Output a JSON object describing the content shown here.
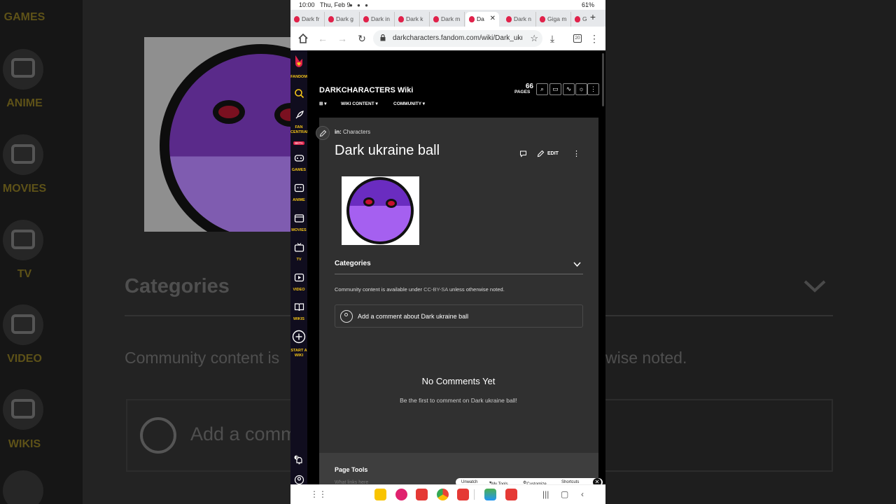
{
  "background": {
    "rail_items": [
      "GAMES",
      "ANIME",
      "MOVIES",
      "TV",
      "VIDEO",
      "WIKIS"
    ],
    "categories_label": "Categories",
    "license_fragment": "Community content is",
    "license_fragment_right": "wise noted.",
    "comment_fragment": "Add a comm"
  },
  "status_bar": {
    "time": "10:00",
    "date": "Thu, Feb 9",
    "battery": "61%"
  },
  "tabs": [
    {
      "label": "Dark fr",
      "active": false
    },
    {
      "label": "Dark g",
      "active": false
    },
    {
      "label": "Dark in",
      "active": false
    },
    {
      "label": "Dark k",
      "active": false
    },
    {
      "label": "Dark m",
      "active": false
    },
    {
      "label": "Da",
      "active": true
    },
    {
      "label": "Dark n",
      "active": false
    },
    {
      "label": "Giga m",
      "active": false
    },
    {
      "label": "G",
      "active": false
    }
  ],
  "browser": {
    "url": "darkcharacters.fandom.com/wiki/Dark_ukr",
    "tab_count": "20"
  },
  "fandom_rail": {
    "logo_label": "FANDOM",
    "items": [
      {
        "label": "FAN CENTRAL",
        "icon": "rocket-icon",
        "badge": "BETA"
      },
      {
        "label": "GAMES",
        "icon": "gamepad-icon"
      },
      {
        "label": "ANIME",
        "icon": "anime-icon"
      },
      {
        "label": "MOVIES",
        "icon": "clapperboard-icon"
      },
      {
        "label": "TV",
        "icon": "tv-icon"
      },
      {
        "label": "VIDEO",
        "icon": "play-icon"
      },
      {
        "label": "WIKIS",
        "icon": "book-icon"
      },
      {
        "label": "START A WIKI",
        "icon": "plus-circle-icon"
      }
    ],
    "notification_count": "2"
  },
  "wiki": {
    "name": "DARKCHARACTERS Wiki",
    "pages_count": "66",
    "pages_label": "PAGES",
    "nav": [
      "WIKI CONTENT",
      "COMMUNITY"
    ]
  },
  "article": {
    "in_label": "in:",
    "category": "Characters",
    "title": "Dark ukraine ball",
    "edit_label": "EDIT",
    "categories_label": "Categories",
    "license_prefix": "Community content is available under ",
    "license_link": "CC-BY-SA",
    "license_suffix": " unless otherwise noted.",
    "comment_prompt": "Add a comment about Dark ukraine ball",
    "no_comments": "No Comments Yet",
    "first_comment": "Be the first to comment on Dark ukraine ball!"
  },
  "page_tools": {
    "title": "Page Tools",
    "sub": "What links here"
  },
  "bottom_toolbar": {
    "unwatch": "Unwatch",
    "my_tools": "My Tools",
    "customize": "Customize",
    "shortcuts": "Shortcuts"
  },
  "colors": {
    "fandom_red": "#e0224a",
    "fandom_yellow": "#f5c518",
    "ball_purple": "#a560f0",
    "ball_eye": "#c8102e"
  }
}
